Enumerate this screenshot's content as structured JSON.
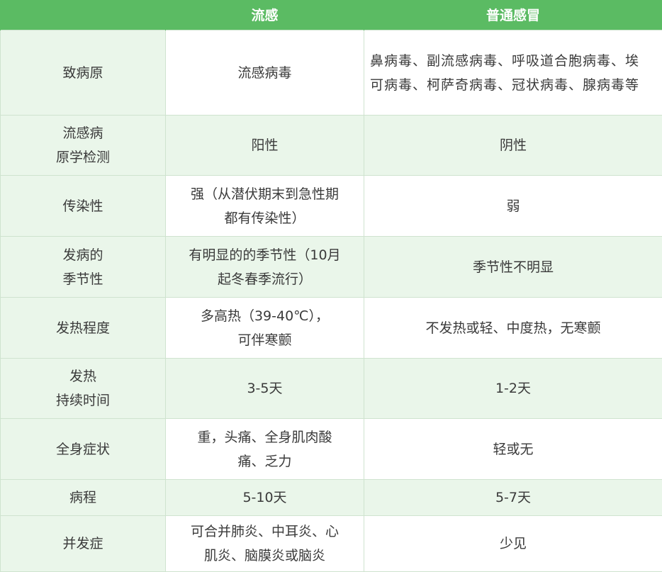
{
  "table": {
    "headers": [
      "",
      "流感",
      "普通感冒"
    ],
    "rows": [
      {
        "label": "致病原",
        "flu": "流感病毒",
        "cold": "鼻病毒、副流感病毒、呼吸道合胞病毒、埃可病毒、柯萨奇病毒、冠状病毒、腺病毒等"
      },
      {
        "label": "流感病\n原学检测",
        "flu": "阳性",
        "cold": "阴性"
      },
      {
        "label": "传染性",
        "flu": "强（从潜伏期末到急性期\n都有传染性）",
        "cold": "弱"
      },
      {
        "label": "发病的\n季节性",
        "flu": "有明显的的季节性（10月\n起冬春季流行）",
        "cold": "季节性不明显"
      },
      {
        "label": "发热程度",
        "flu": "多高热（39-40℃），\n可伴寒颤",
        "cold": "不发热或轻、中度热，无寒颤"
      },
      {
        "label": "发热\n持续时间",
        "flu": "3-5天",
        "cold": "1-2天"
      },
      {
        "label": "全身症状",
        "flu": "重，头痛、全身肌肉酸\n痛、乏力",
        "cold": "轻或无"
      },
      {
        "label": "病程",
        "flu": "5-10天",
        "cold": "5-7天"
      },
      {
        "label": "并发症",
        "flu": "可合并肺炎、中耳炎、心\n肌炎、脑膜炎或脑炎",
        "cold": "少见"
      }
    ]
  }
}
